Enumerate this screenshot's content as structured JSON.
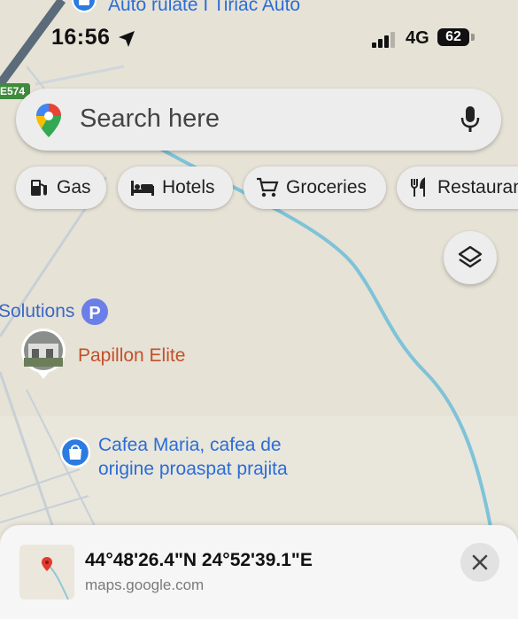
{
  "status_bar": {
    "time": "16:56",
    "network": "4G",
    "battery": "62"
  },
  "search": {
    "placeholder": "Search here"
  },
  "chips": [
    {
      "label": "Gas",
      "icon": "gas-station-icon"
    },
    {
      "label": "Hotels",
      "icon": "bed-icon"
    },
    {
      "label": "Groceries",
      "icon": "cart-icon"
    },
    {
      "label": "Restaurants",
      "icon": "restaurant-icon"
    }
  ],
  "map": {
    "road_badge": "E574",
    "top_place": "Auto rulate I Tiriac Auto",
    "solutions_label": "Solutions",
    "parking_label": "P",
    "papillon_label": "Papillon Elite",
    "cafea_line1": "Cafea Maria, cafea de",
    "cafea_line2": "origine proaspat prajita",
    "colors": {
      "road_blue": "#7ec3d8",
      "place_blue": "#2b6dd6",
      "papillon_orange": "#c2502a",
      "parking": "#6b7fe8"
    }
  },
  "sheet": {
    "coordinates": "44°48'26.4\"N 24°52'39.1\"E",
    "domain": "maps.google.com"
  }
}
